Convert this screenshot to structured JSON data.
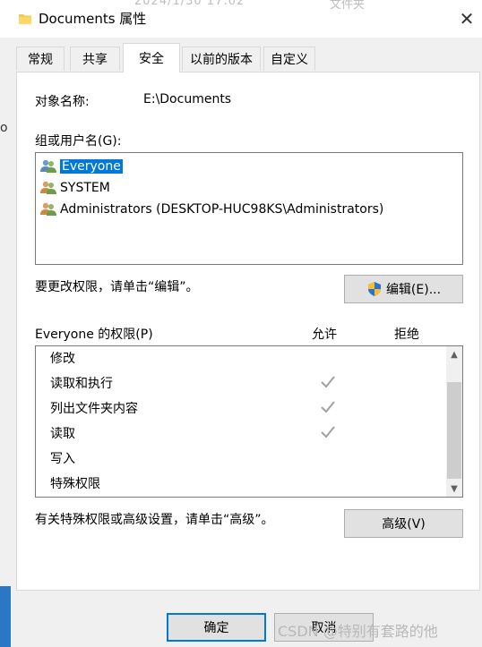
{
  "window": {
    "title": "Documents 属性",
    "background_ghost_left": "2024/1/30 17:02",
    "background_ghost_right": "文件夹",
    "left_edge_mark": "o"
  },
  "tabs": [
    {
      "label": "常规"
    },
    {
      "label": "共享"
    },
    {
      "label": "安全"
    },
    {
      "label": "以前的版本"
    },
    {
      "label": "自定义"
    }
  ],
  "security": {
    "object_name_label": "对象名称:",
    "object_name_value": "E:\\Documents",
    "groups_label": "组或用户名(G):",
    "users": [
      {
        "name": "Everyone",
        "selected": true
      },
      {
        "name": "SYSTEM",
        "selected": false
      },
      {
        "name": "Administrators (DESKTOP-HUC98KS\\Administrators)",
        "selected": false
      }
    ],
    "edit_hint": "要更改权限，请单击“编辑”。",
    "edit_button": "编辑(E)...",
    "perm_header": "Everyone 的权限(P)",
    "allow_header": "允许",
    "deny_header": "拒绝",
    "permissions": [
      {
        "name": "修改",
        "allow": false
      },
      {
        "name": "读取和执行",
        "allow": true
      },
      {
        "name": "列出文件夹内容",
        "allow": true
      },
      {
        "name": "读取",
        "allow": true
      },
      {
        "name": "写入",
        "allow": false
      },
      {
        "name": "特殊权限",
        "allow": false
      }
    ],
    "advanced_hint": "有关特殊权限或高级设置，请单击“高级”。",
    "advanced_button": "高级(V)"
  },
  "footer": {
    "ok_button": "确定",
    "cancel_button": "取消"
  },
  "watermark": "CSDN @特别有套路的他",
  "colors": {
    "selection": "#0078d7",
    "check": "#a0a0a0",
    "taskbar": "#2a78c4"
  },
  "icons": {
    "folder": "folder-icon",
    "close": "close-icon",
    "users": "users-icon",
    "shield": "shield-icon",
    "check": "check-icon"
  }
}
